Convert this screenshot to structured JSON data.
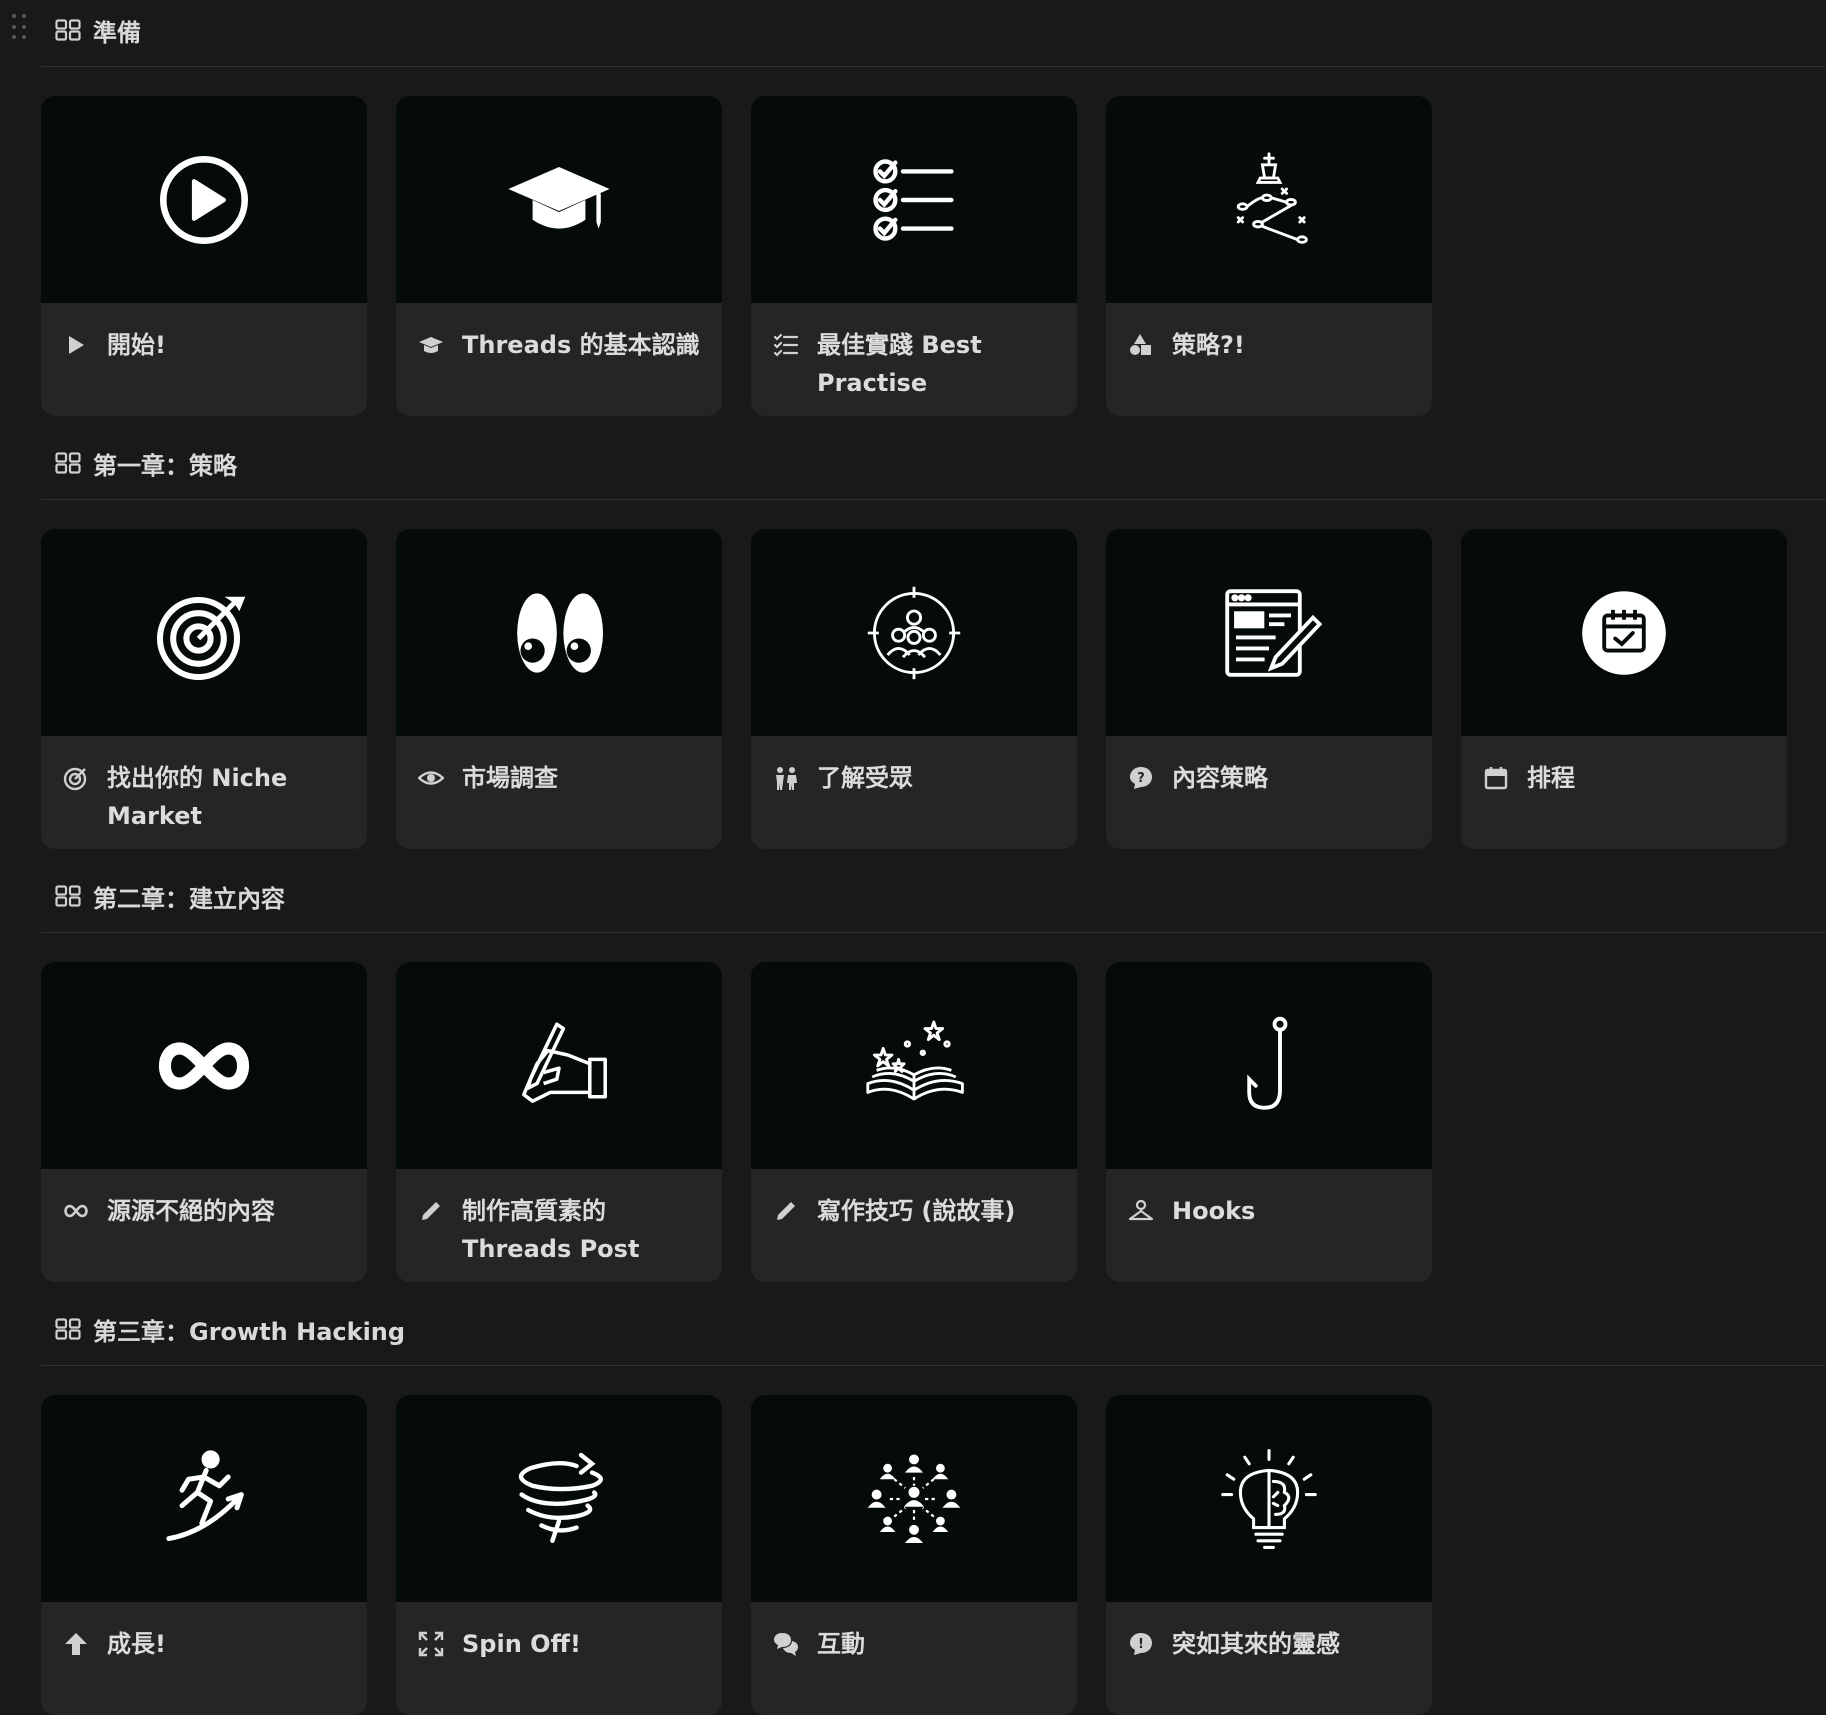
{
  "sections": [
    {
      "title": "準備",
      "cards": [
        {
          "label": "開始!",
          "cover_icon": "play-circle-icon",
          "small_icon": "play-icon"
        },
        {
          "label": "Threads 的基本認識",
          "cover_icon": "graduation-cap-icon",
          "small_icon": "graduation-cap-small-icon"
        },
        {
          "label": "最佳實踐 Best Practise",
          "cover_icon": "checklist-icon",
          "small_icon": "checklist-small-icon"
        },
        {
          "label": "策略?!",
          "cover_icon": "chess-strategy-icon",
          "small_icon": "shapes-icon"
        }
      ]
    },
    {
      "title": "第一章：策略",
      "cards": [
        {
          "label": "找出你的 Niche Market",
          "cover_icon": "target-arrow-icon",
          "small_icon": "target-small-icon"
        },
        {
          "label": "市場調查",
          "cover_icon": "eyes-icon",
          "small_icon": "eye-icon"
        },
        {
          "label": "了解受眾",
          "cover_icon": "audience-target-icon",
          "small_icon": "people-icon"
        },
        {
          "label": "內容策略",
          "cover_icon": "content-edit-icon",
          "small_icon": "question-bubble-icon"
        },
        {
          "label": "排程",
          "cover_icon": "calendar-check-icon",
          "small_icon": "calendar-icon"
        }
      ]
    },
    {
      "title": "第二章：建立內容",
      "cards": [
        {
          "label": "源源不絕的內容",
          "cover_icon": "infinity-icon",
          "small_icon": "infinity-small-icon"
        },
        {
          "label": "制作高質素的 Threads Post",
          "cover_icon": "hand-writing-icon",
          "small_icon": "pencil-icon"
        },
        {
          "label": "寫作技巧 (說故事)",
          "cover_icon": "magic-book-icon",
          "small_icon": "pencil-icon"
        },
        {
          "label": "Hooks",
          "cover_icon": "fish-hook-icon",
          "small_icon": "hanger-icon"
        }
      ]
    },
    {
      "title": "第三章：Growth Hacking",
      "cards": [
        {
          "label": "成長!",
          "cover_icon": "runner-uphill-icon",
          "small_icon": "arrow-up-icon"
        },
        {
          "label": "Spin Off!",
          "cover_icon": "spiral-arrow-icon",
          "small_icon": "expand-icon"
        },
        {
          "label": "互動",
          "cover_icon": "network-people-icon",
          "small_icon": "chat-bubbles-icon"
        },
        {
          "label": "突如其來的靈感",
          "cover_icon": "lightbulb-brain-icon",
          "small_icon": "exclamation-bubble-icon"
        }
      ]
    }
  ]
}
